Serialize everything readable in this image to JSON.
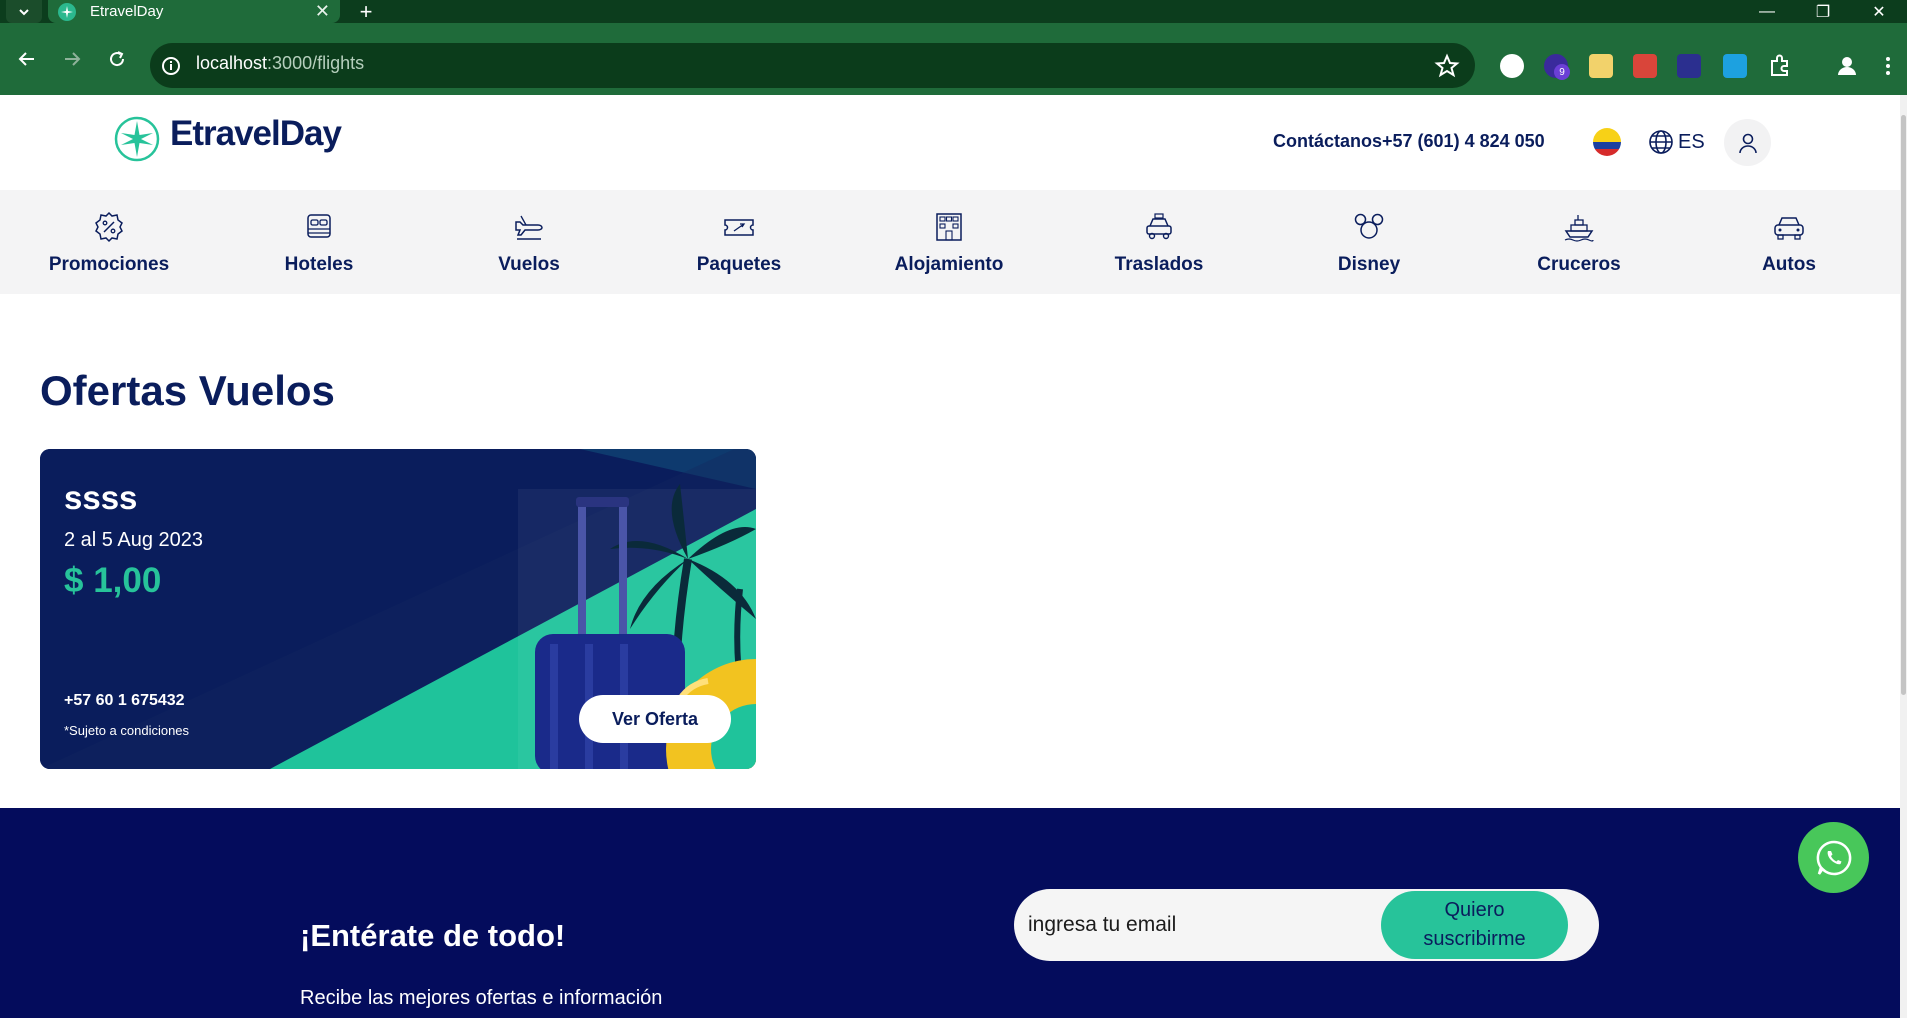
{
  "browser": {
    "tab_title": "EtravelDay",
    "url_host": "localhost",
    "url_path": ":3000/flights",
    "extension_badge": "9",
    "theme_color": "#1f6b3a"
  },
  "header": {
    "logo_text": "EtravelDay",
    "contact": "Contáctanos+57 (601) 4 824 050",
    "language": "ES",
    "brand_color": "#0a1d5c",
    "accent_color": "#27c39a"
  },
  "nav": {
    "items": [
      {
        "label": "Promociones",
        "icon": "percent-badge-icon"
      },
      {
        "label": "Hoteles",
        "icon": "bed-icon"
      },
      {
        "label": "Vuelos",
        "icon": "plane-icon"
      },
      {
        "label": "Paquetes",
        "icon": "ticket-icon"
      },
      {
        "label": "Alojamiento",
        "icon": "building-icon"
      },
      {
        "label": "Traslados",
        "icon": "car-transfer-icon"
      },
      {
        "label": "Disney",
        "icon": "mickey-icon"
      },
      {
        "label": "Cruceros",
        "icon": "ship-icon"
      },
      {
        "label": "Autos",
        "icon": "car-icon"
      }
    ]
  },
  "main": {
    "title": "Ofertas Vuelos",
    "offer": {
      "title": "ssss",
      "dates": "2 al 5 Aug 2023",
      "price": "$ 1,00",
      "phone": "+57 60 1 675432",
      "terms": "*Sujeto a condiciones",
      "button": "Ver Oferta"
    }
  },
  "newsletter": {
    "heading": "¡Entérate de todo!",
    "subtext": "Recibe las mejores ofertas e información",
    "email_placeholder": "ingresa tu email",
    "button_line1": "Quiero",
    "button_line2": "suscribirme"
  }
}
